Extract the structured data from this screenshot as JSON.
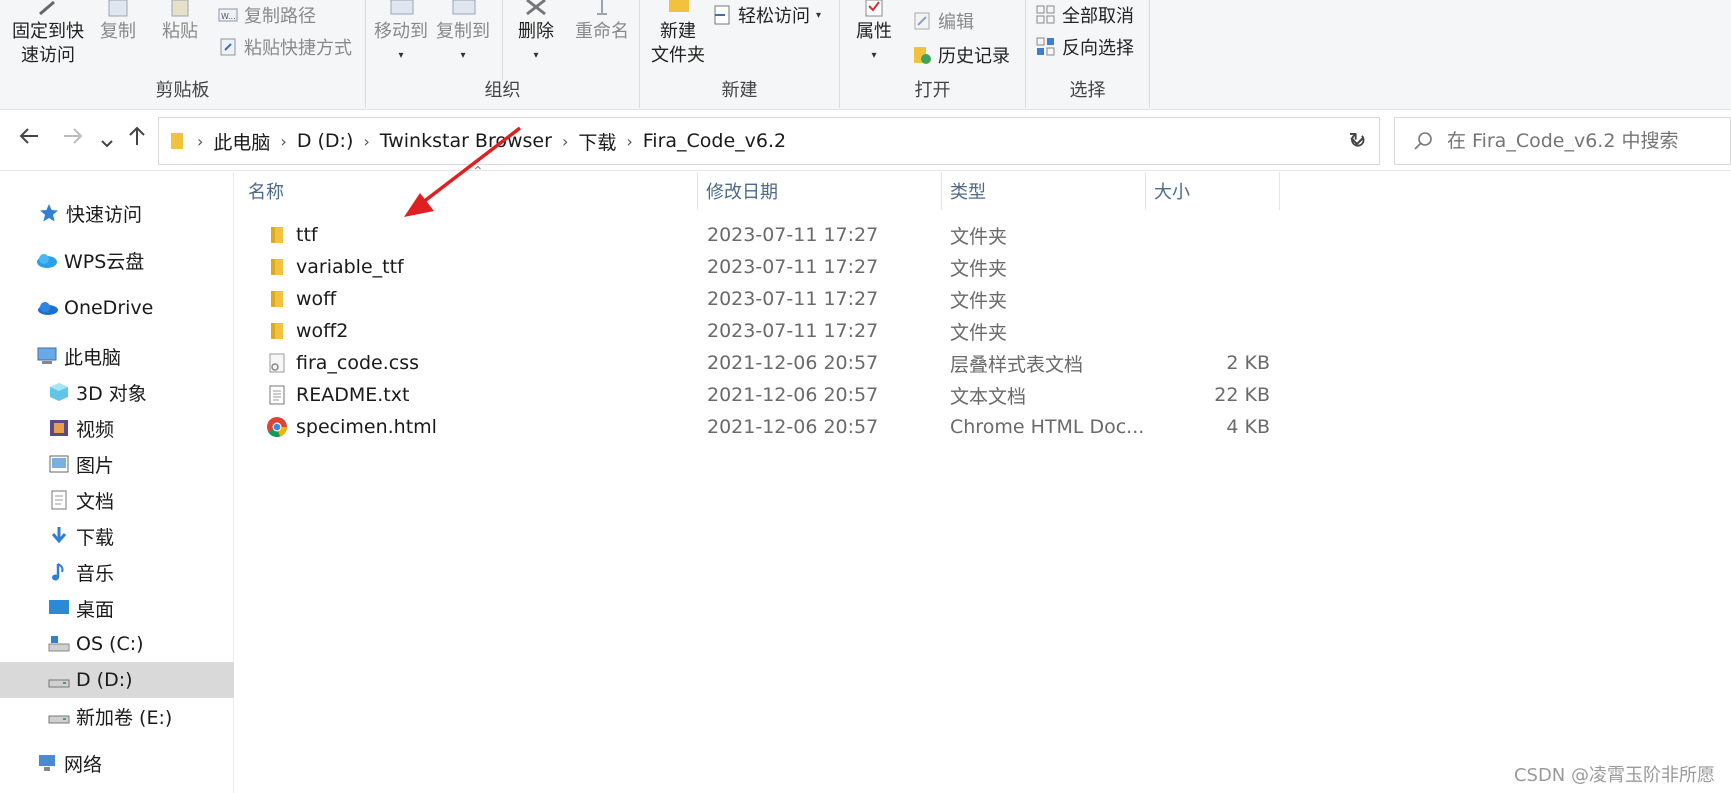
{
  "ribbon": {
    "clipboard": {
      "pin_label": "固定到快\n速访问",
      "copy_label": "复制",
      "paste_label": "粘贴",
      "copy_path_label": "复制路径",
      "paste_shortcut_label": "粘贴快捷方式",
      "group_label": "剪贴板"
    },
    "organize": {
      "move_to_label": "移动到",
      "copy_to_label": "复制到",
      "delete_label": "删除",
      "rename_label": "重命名",
      "group_label": "组织"
    },
    "new": {
      "new_folder_label": "新建\n文件夹",
      "easy_access_label": "轻松访问",
      "group_label": "新建"
    },
    "open": {
      "properties_label": "属性",
      "edit_label": "编辑",
      "history_label": "历史记录",
      "group_label": "打开"
    },
    "select": {
      "select_none_label": "全部取消",
      "invert_label": "反向选择",
      "group_label": "选择"
    }
  },
  "address": {
    "crumbs": [
      "此电脑",
      "D (D:)",
      "Twinkstar Browser",
      "下载",
      "Fira_Code_v6.2"
    ]
  },
  "search": {
    "placeholder": "在 Fira_Code_v6.2 中搜索"
  },
  "sidebar": {
    "items": [
      {
        "label": "快速访问",
        "icon": "star-icon"
      },
      {
        "label": "WPS云盘",
        "icon": "cloud-icon"
      },
      {
        "label": "OneDrive",
        "icon": "onedrive-icon"
      },
      {
        "label": "此电脑",
        "icon": "pc-icon"
      },
      {
        "label": "3D 对象",
        "icon": "cube-icon"
      },
      {
        "label": "视频",
        "icon": "video-icon"
      },
      {
        "label": "图片",
        "icon": "picture-icon"
      },
      {
        "label": "文档",
        "icon": "document-icon"
      },
      {
        "label": "下载",
        "icon": "download-icon"
      },
      {
        "label": "音乐",
        "icon": "music-icon"
      },
      {
        "label": "桌面",
        "icon": "desktop-icon"
      },
      {
        "label": "OS (C:)",
        "icon": "drive-c-icon"
      },
      {
        "label": "D (D:)",
        "icon": "drive-icon"
      },
      {
        "label": "新加卷 (E:)",
        "icon": "drive-icon"
      },
      {
        "label": "网络",
        "icon": "network-icon"
      }
    ]
  },
  "columns": {
    "name": "名称",
    "date": "修改日期",
    "type": "类型",
    "size": "大小"
  },
  "files": [
    {
      "name": "ttf",
      "date": "2023-07-11 17:27",
      "type": "文件夹",
      "size": "",
      "icon": "folder-icon"
    },
    {
      "name": "variable_ttf",
      "date": "2023-07-11 17:27",
      "type": "文件夹",
      "size": "",
      "icon": "folder-icon"
    },
    {
      "name": "woff",
      "date": "2023-07-11 17:27",
      "type": "文件夹",
      "size": "",
      "icon": "folder-icon"
    },
    {
      "name": "woff2",
      "date": "2023-07-11 17:27",
      "type": "文件夹",
      "size": "",
      "icon": "folder-icon"
    },
    {
      "name": "fira_code.css",
      "date": "2021-12-06 20:57",
      "type": "层叠样式表文档",
      "size": "2 KB",
      "icon": "css-file-icon"
    },
    {
      "name": "README.txt",
      "date": "2021-12-06 20:57",
      "type": "文本文档",
      "size": "22 KB",
      "icon": "text-file-icon"
    },
    {
      "name": "specimen.html",
      "date": "2021-12-06 20:57",
      "type": "Chrome HTML Doc...",
      "size": "4 KB",
      "icon": "chrome-icon"
    }
  ],
  "watermark": "CSDN @凌霄玉阶非所愿",
  "colors": {
    "folder": "#f3c23c",
    "selected_bg": "#d9d9d9",
    "header_text": "#4d6a8a",
    "annotation_arrow": "#e02020"
  }
}
